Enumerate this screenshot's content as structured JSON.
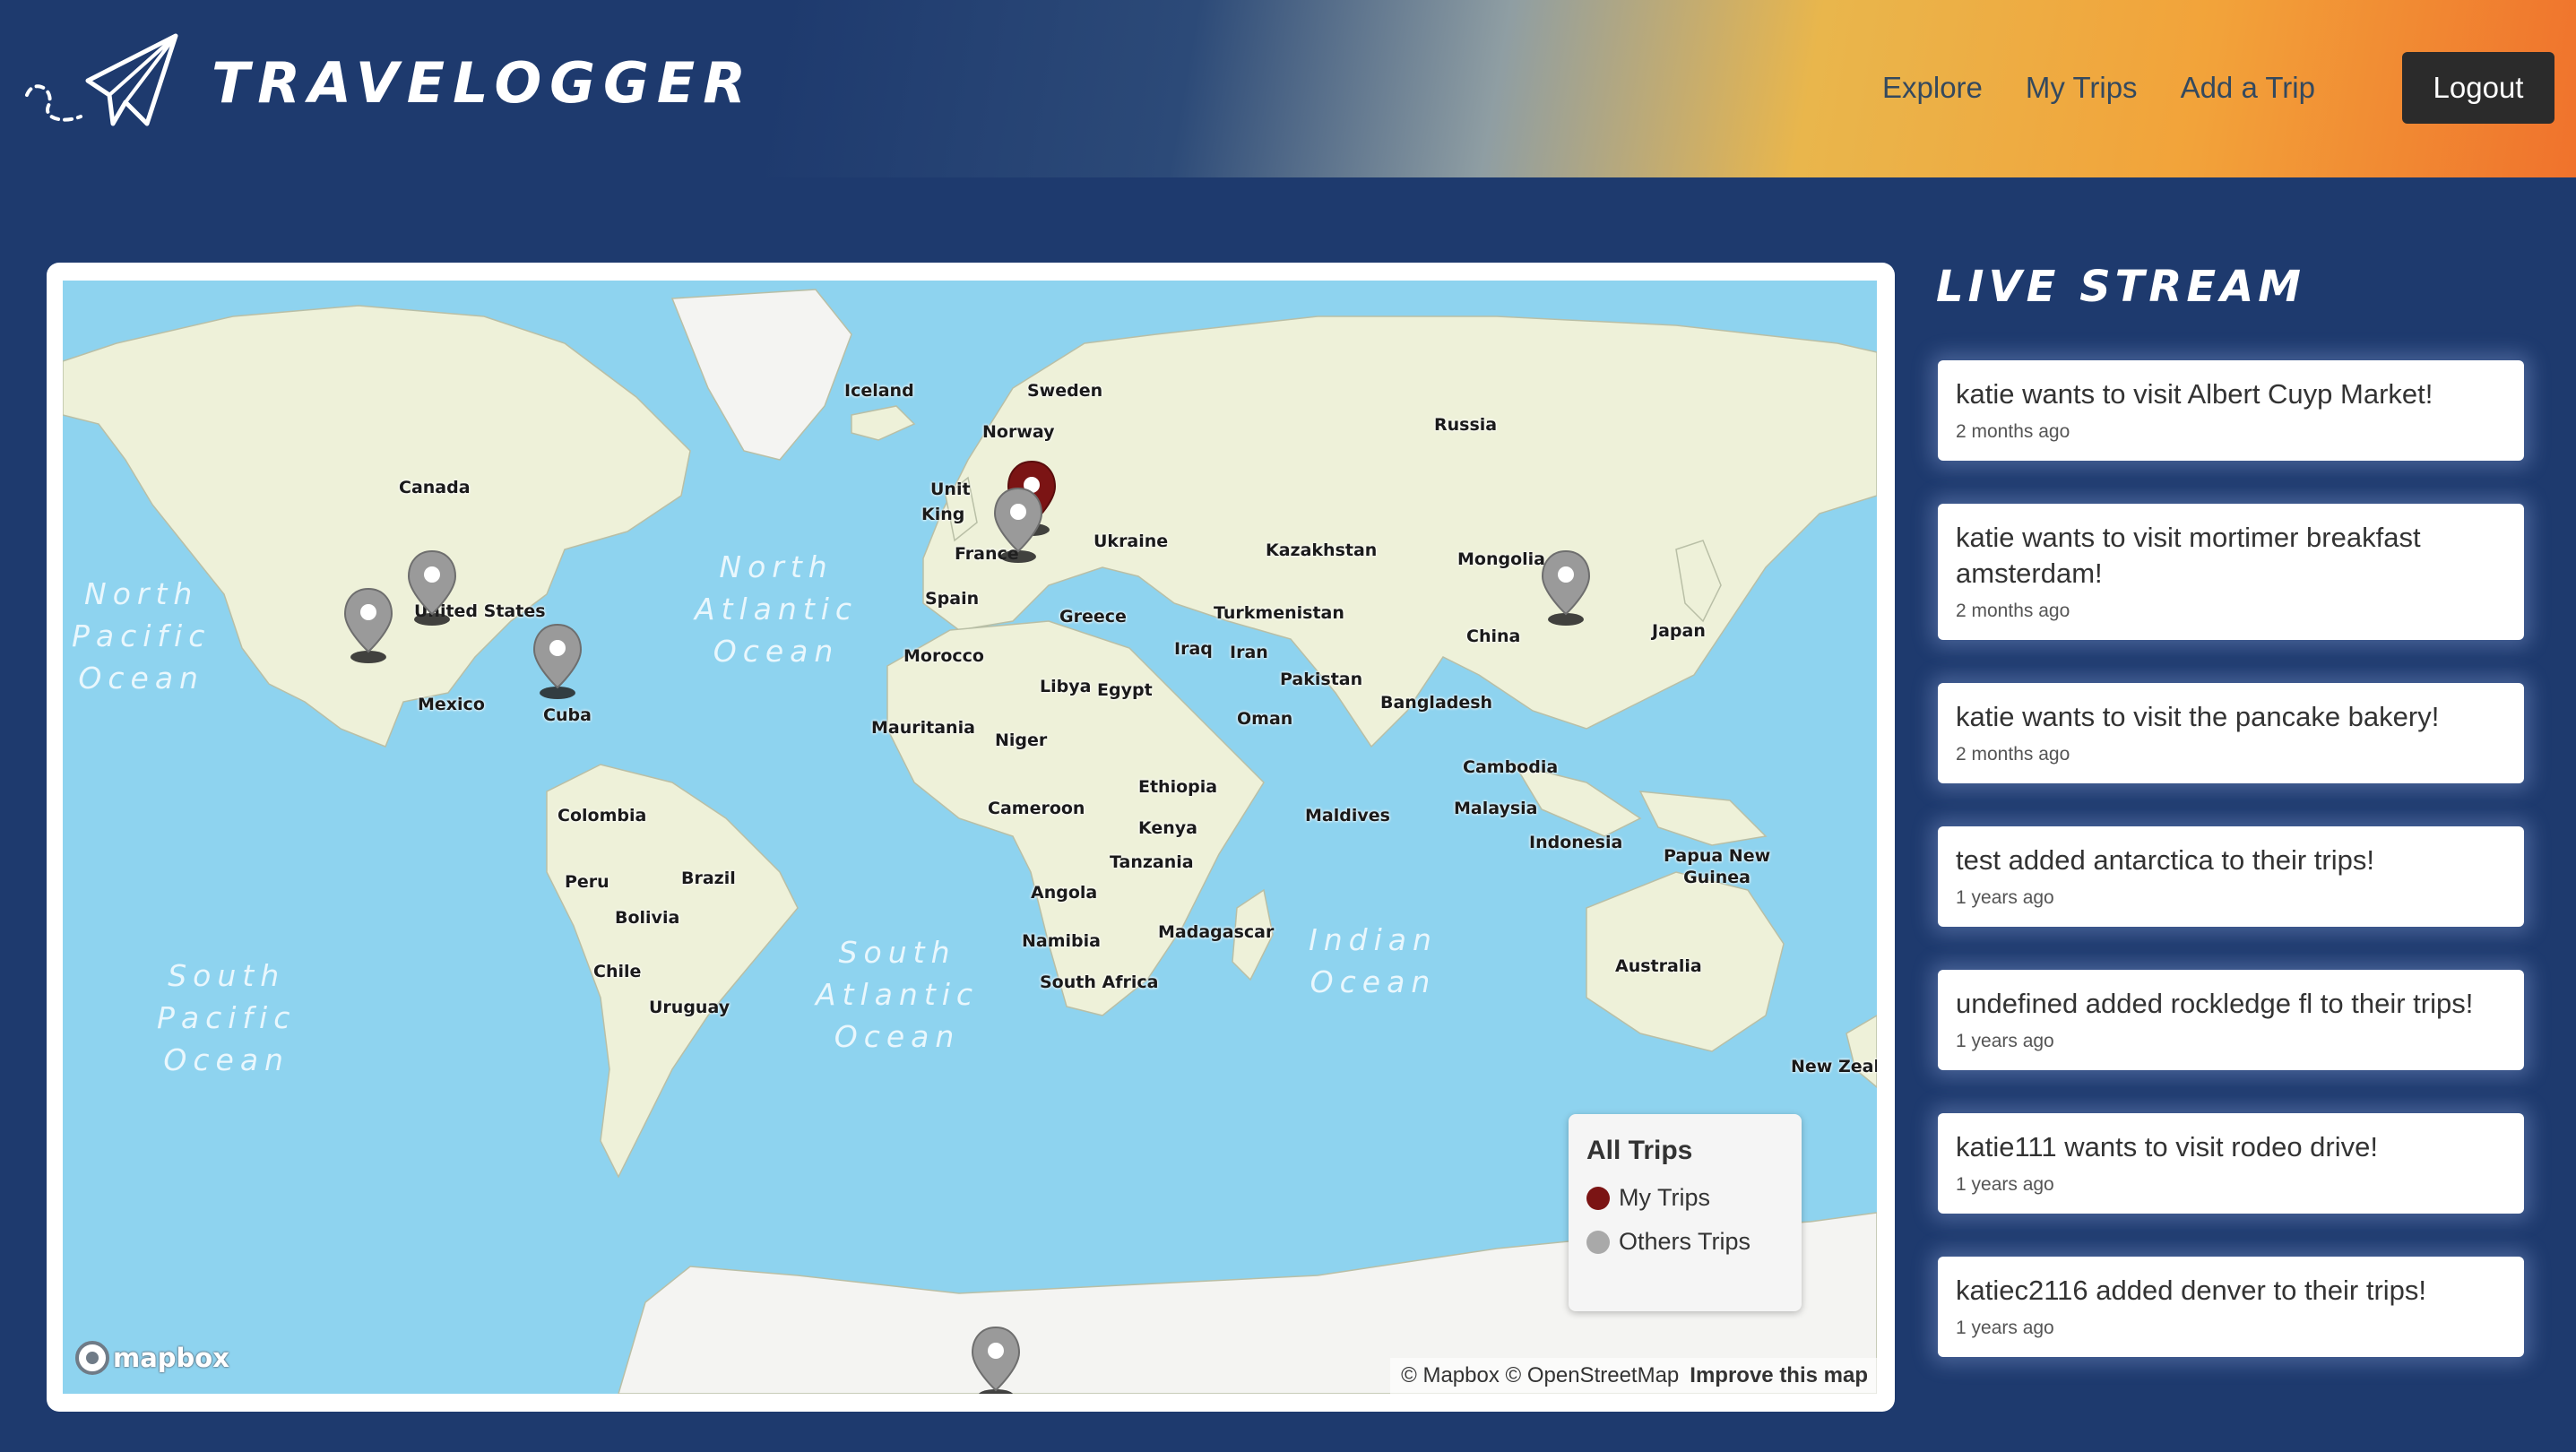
{
  "brand": {
    "name": "TRAVELOGGER",
    "logo_icon": "paper-plane-icon"
  },
  "nav": {
    "links": [
      "Explore",
      "My Trips",
      "Add a Trip"
    ],
    "logout": "Logout"
  },
  "map": {
    "countries": [
      "Iceland",
      "Sweden",
      "Norway",
      "Russia",
      "Canada",
      "Unit",
      "King",
      "France",
      "Ukraine",
      "Kazakhstan",
      "Mongolia",
      "United States",
      "Spain",
      "Greece",
      "Turkmenistan",
      "China",
      "Japan",
      "Morocco",
      "Iraq",
      "Iran",
      "Pakistan",
      "Mexico",
      "Cuba",
      "Libya",
      "Egypt",
      "Oman",
      "Bangladesh",
      "Mauritania",
      "Niger",
      "Cambodia",
      "Ethiopia",
      "Colombia",
      "Cameroon",
      "Maldives",
      "Malaysia",
      "Kenya",
      "Indonesia",
      "Papua New\nGuinea",
      "Peru",
      "Brazil",
      "Tanzania",
      "Angola",
      "Bolivia",
      "Namibia",
      "Madagascar",
      "Chile",
      "South Africa",
      "Uruguay",
      "Australia",
      "New Zeala"
    ],
    "oceans": [
      "North\nPacific\nOcean",
      "North\nAtlantic\nOcean",
      "South\nPacific\nOcean",
      "South\nAtlantic\nOcean",
      "Indian\nOcean"
    ],
    "legend": {
      "title": "All Trips",
      "items": [
        {
          "label": "My Trips",
          "color": "#7b1414"
        },
        {
          "label": "Others Trips",
          "color": "#a9a9a9"
        }
      ]
    },
    "mapbox_logo": "mapbox",
    "attribution": "© Mapbox © OpenStreetMap",
    "improve": "Improve this map",
    "colors": {
      "water": "#8ed3ef",
      "land": "#eef1d9",
      "ice": "#f4f4f2",
      "my_pin": "#7b1414",
      "other_pin": "#9a9a9a"
    }
  },
  "stream": {
    "title": "LIVE STREAM",
    "items": [
      {
        "text": "katie wants to visit Albert Cuyp Market!",
        "time": "2 months ago"
      },
      {
        "text": "katie wants to visit mortimer breakfast amsterdam!",
        "time": "2 months ago"
      },
      {
        "text": "katie wants to visit the pancake bakery!",
        "time": "2 months ago"
      },
      {
        "text": "test added antarctica to their trips!",
        "time": "1 years ago"
      },
      {
        "text": "undefined added rockledge fl to their trips!",
        "time": "1 years ago"
      },
      {
        "text": "katie111 wants to visit rodeo drive!",
        "time": "1 years ago"
      },
      {
        "text": "katiec2116 added denver to their trips!",
        "time": "1 years ago"
      }
    ]
  }
}
